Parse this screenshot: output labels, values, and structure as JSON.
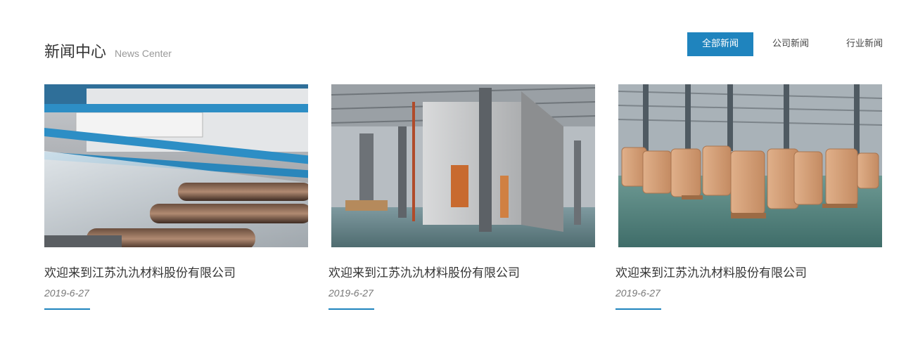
{
  "section": {
    "title": "新闻中心",
    "subtitle": "News Center"
  },
  "tabs": [
    {
      "label": "全部新闻",
      "active": true
    },
    {
      "label": "公司新闻",
      "active": false
    },
    {
      "label": "行业新闻",
      "active": false
    }
  ],
  "news": [
    {
      "title": "欢迎来到江苏氿氿材料股份有限公司",
      "date": "2019-6-27",
      "image": "film-production-line-photo"
    },
    {
      "title": "欢迎来到江苏氿氿材料股份有限公司",
      "date": "2019-6-27",
      "image": "factory-workshop-photo"
    },
    {
      "title": "欢迎来到江苏氿氿材料股份有限公司",
      "date": "2019-6-27",
      "image": "warehouse-bulk-bags-photo"
    }
  ],
  "colors": {
    "accent": "#1f84be",
    "title": "#333333",
    "subtitle": "#999999",
    "date": "#777777"
  }
}
